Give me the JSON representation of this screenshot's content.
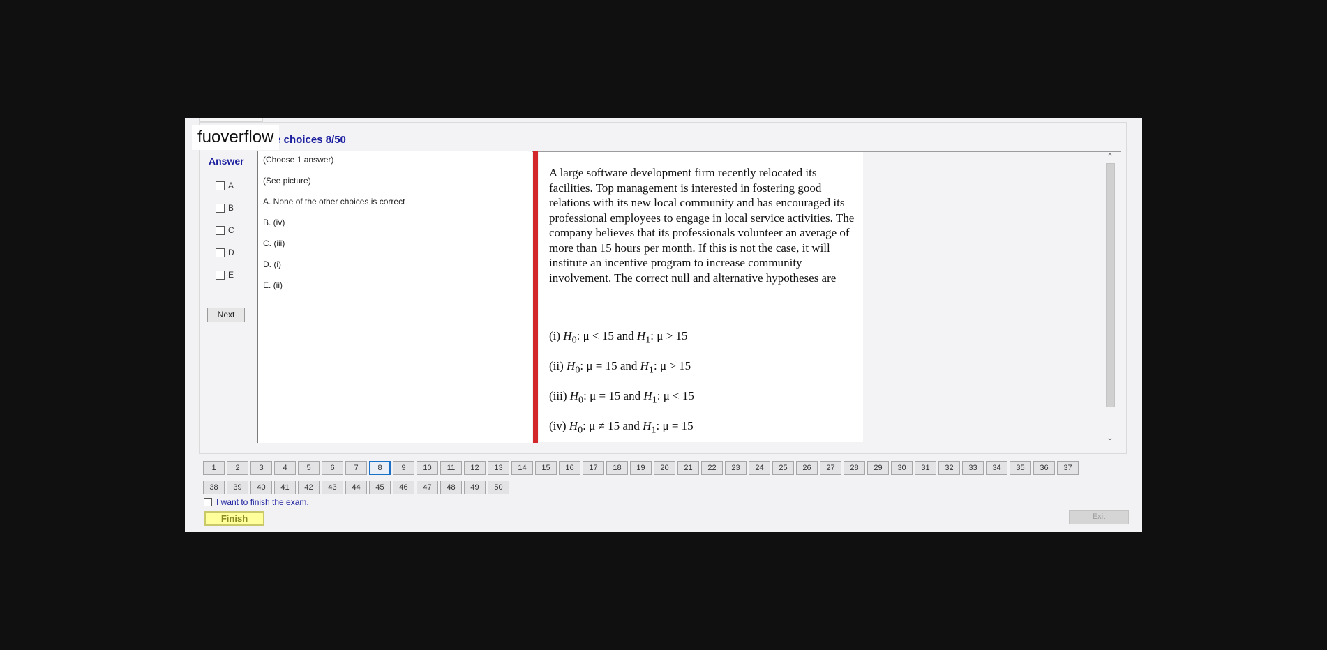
{
  "watermark": "fuoverflow",
  "section_title": "le choices 8/50",
  "answer": {
    "label": "Answer",
    "options": [
      "A",
      "B",
      "C",
      "D",
      "E"
    ],
    "next_label": "Next"
  },
  "choices": [
    "(Choose 1 answer)",
    "(See picture)",
    "A.  None of the other choices is correct",
    "B.  (iv)",
    "C.  (iii)",
    "D.  (i)",
    "E.  (ii)"
  ],
  "question": {
    "text": "A large software development firm recently relocated its facilities. Top management is interested in fostering good relations with its new local community and has encouraged its professional employees to engage in local service activities. The company believes that its professionals volunteer an average of more than 15 hours per month. If this is not the case, it will institute an incentive program to increase community involvement. The correct null and alternative hypotheses are",
    "hypotheses": [
      {
        "num": "(i)",
        "h0": "μ < 15",
        "h1": "μ > 15"
      },
      {
        "num": "(ii)",
        "h0": "μ = 15",
        "h1": "μ > 15"
      },
      {
        "num": "(iii)",
        "h0": "μ = 15",
        "h1": "μ < 15"
      },
      {
        "num": "(iv)",
        "h0": "μ ≠ 15",
        "h1": "μ = 15"
      }
    ],
    "and_word": "and"
  },
  "scrollbar": {
    "up": "⌃",
    "down": "⌄"
  },
  "navigation": {
    "current": "8",
    "row1": [
      "1",
      "2",
      "3",
      "4",
      "5",
      "6",
      "7",
      "8",
      "9",
      "10",
      "11",
      "12",
      "13",
      "14",
      "15",
      "16",
      "17",
      "18",
      "19",
      "20",
      "21",
      "22",
      "23",
      "24",
      "25",
      "26",
      "27",
      "28",
      "29",
      "30",
      "31",
      "32",
      "33",
      "34",
      "35",
      "36",
      "37"
    ],
    "row2": [
      "38",
      "39",
      "40",
      "41",
      "42",
      "43",
      "44",
      "45",
      "46",
      "47",
      "48",
      "49",
      "50"
    ]
  },
  "finish_check_label": "I want to finish the exam.",
  "finish_label": "Finish",
  "exit_label": "Exit"
}
